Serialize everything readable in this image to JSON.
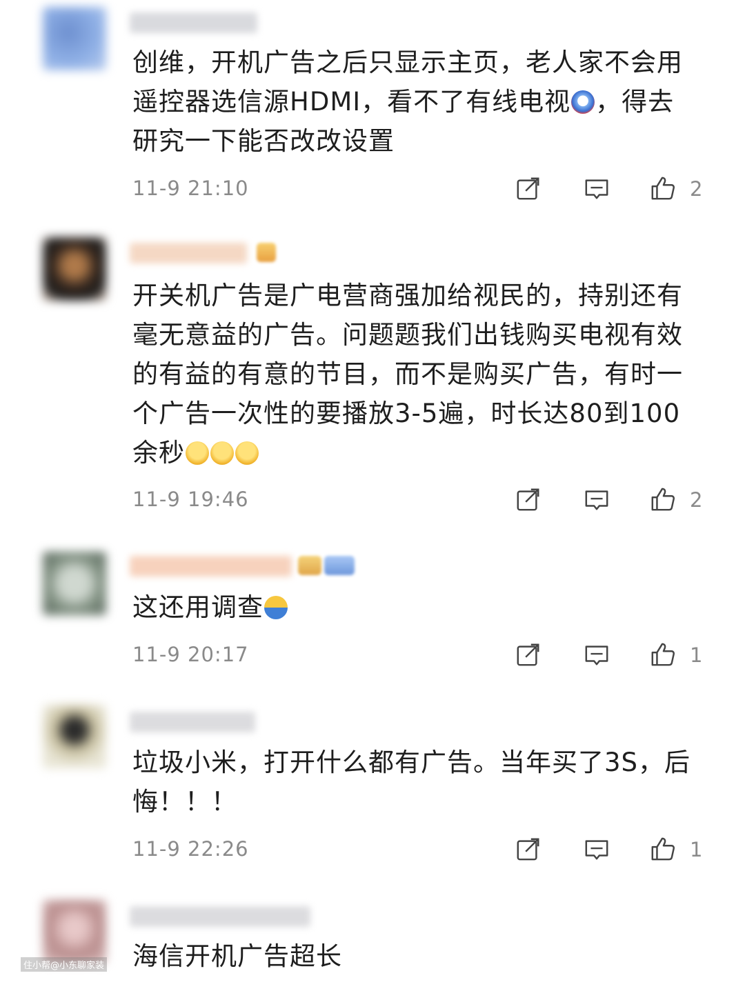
{
  "comments": [
    {
      "lines": [
        "创维，开机广告之后只显示主页，老人家不会用",
        "遥控器选信源HDMI，看不了有线电视",
        "，得去",
        "研究一下能否改改设置"
      ],
      "time": "11-9 21:10",
      "likes": "2"
    },
    {
      "lines": [
        "开关机广告是广电营商强加给视民的，持别还有",
        "毫无意益的广告。问题题我们出钱购买电视有效",
        "的有益的有意的节目，而不是购买广告，有时一",
        "个广告一次性的要播放3-5遍，时长达80到100",
        "余秒"
      ],
      "time": "11-9 19:46",
      "likes": "2"
    },
    {
      "lines": [
        "这还用调查"
      ],
      "time": "11-9 20:17",
      "likes": "1"
    },
    {
      "lines": [
        "垃圾小米，打开什么都有广告。当年买了3S，后",
        "悔！！！"
      ],
      "time": "11-9 22:26",
      "likes": "1"
    },
    {
      "lines": [
        "海信开机广告超长"
      ]
    }
  ],
  "watermark": "住小帮@小东聊家装",
  "colors": {
    "text": "#1e1e1e",
    "meta": "#8a8a8a",
    "icon": "#444444"
  },
  "icons": [
    "share-icon",
    "reply-icon",
    "like-icon",
    "crying-emoji-icon",
    "hat-emoji-icon"
  ]
}
